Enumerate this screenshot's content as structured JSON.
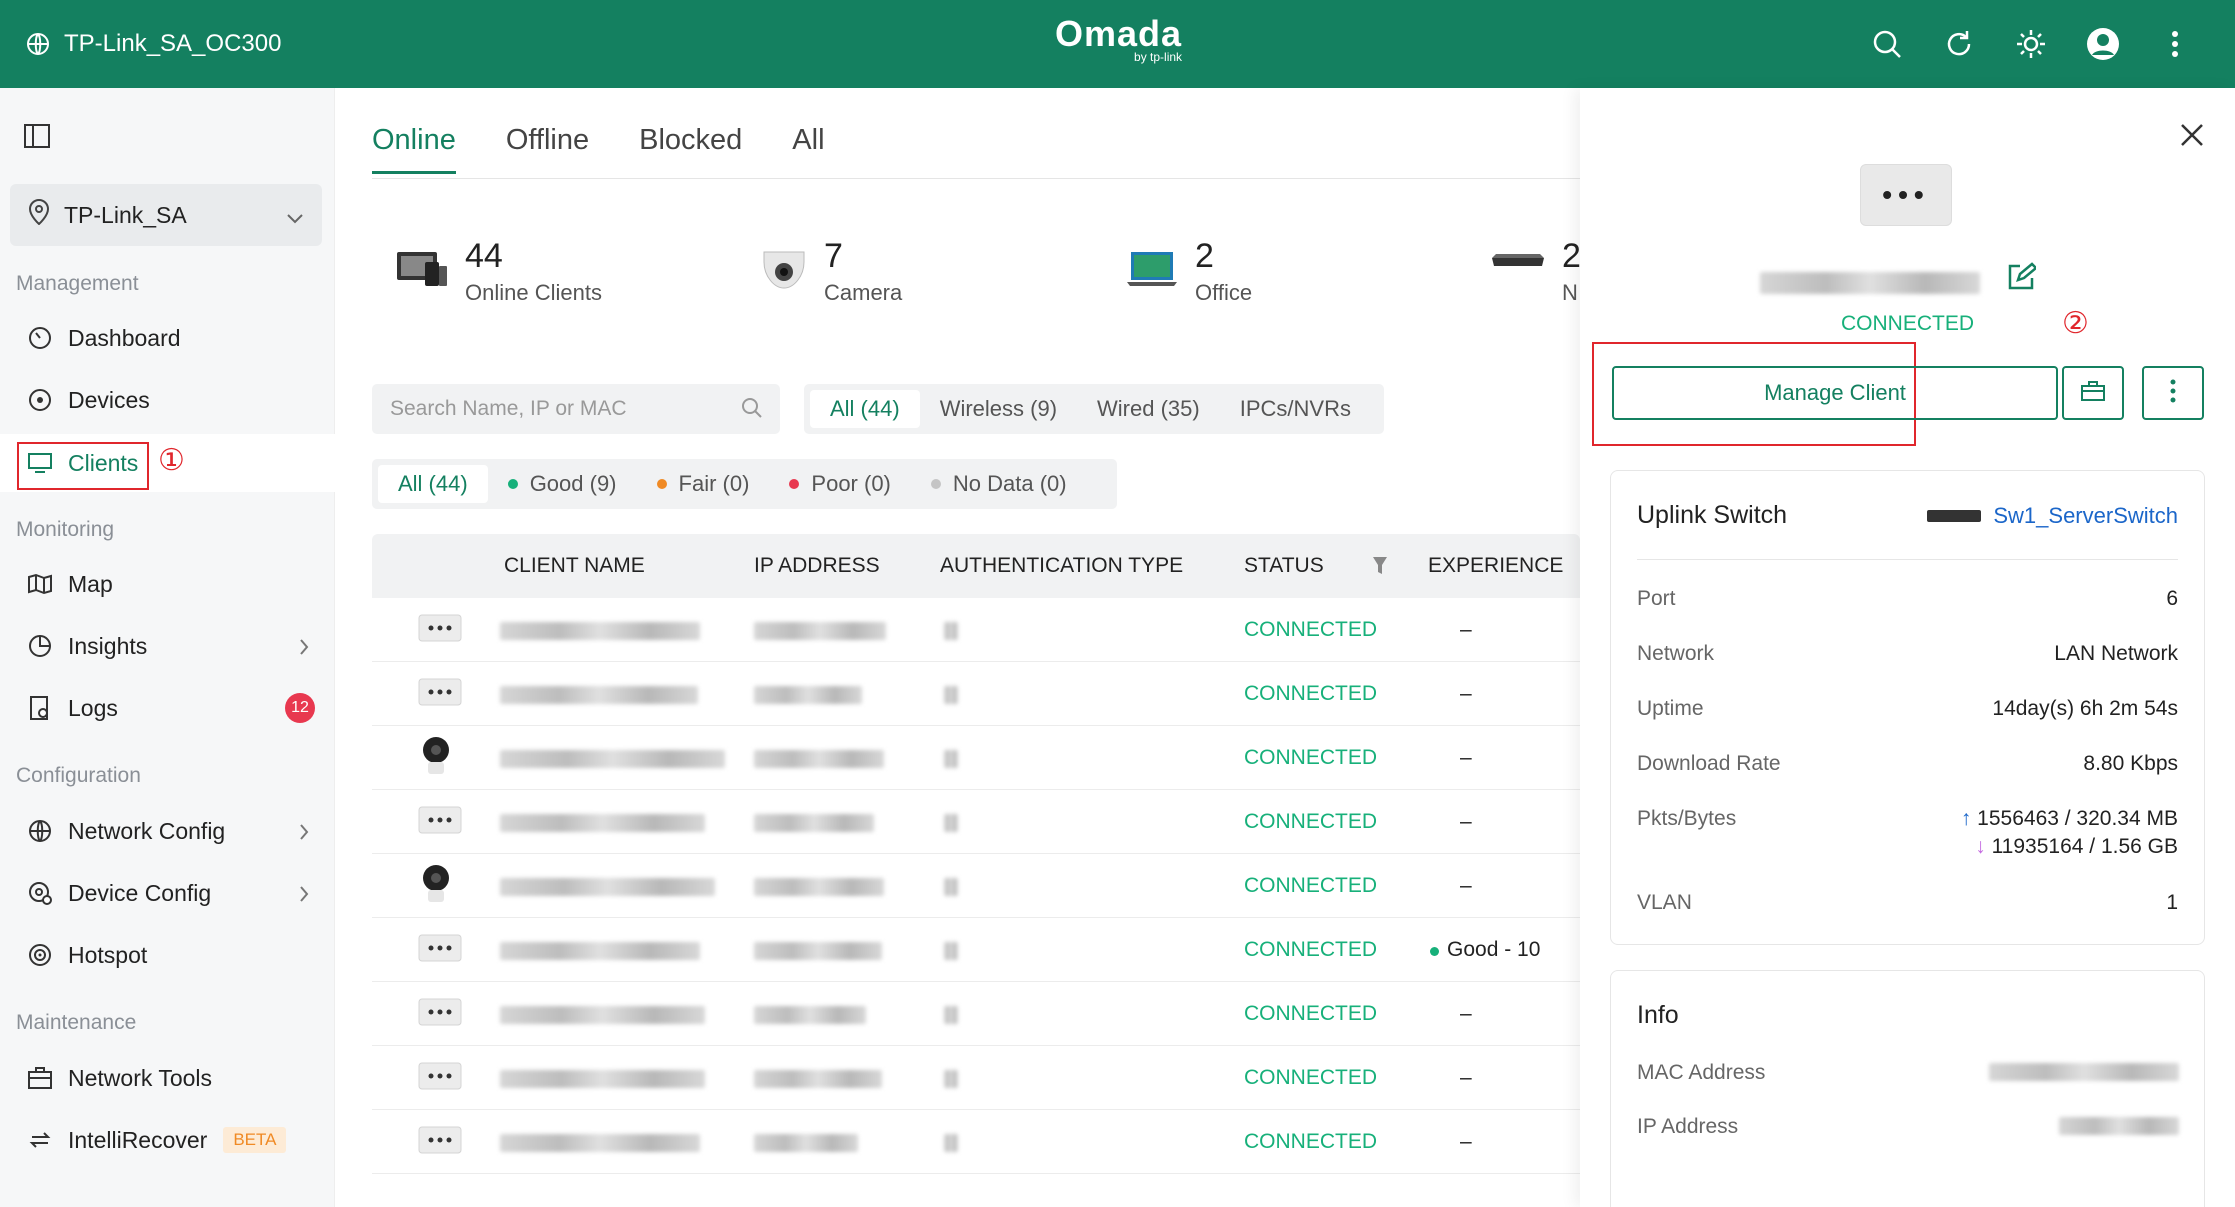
{
  "header": {
    "site_name": "TP-Link_SA_OC300",
    "logo": "Omada",
    "logo_sub": "by tp-link"
  },
  "sidebar": {
    "site_select": "TP-Link_SA",
    "sections": {
      "management": "Management",
      "monitoring": "Monitoring",
      "configuration": "Configuration",
      "maintenance": "Maintenance"
    },
    "items": {
      "dashboard": "Dashboard",
      "devices": "Devices",
      "clients": "Clients",
      "map": "Map",
      "insights": "Insights",
      "logs": "Logs",
      "logs_badge": "12",
      "network_config": "Network Config",
      "device_config": "Device Config",
      "hotspot": "Hotspot",
      "network_tools": "Network Tools",
      "intellirecover": "IntelliRecover",
      "beta": "BETA"
    },
    "annotation_1": "①"
  },
  "main": {
    "tabs": [
      "Online",
      "Offline",
      "Blocked",
      "All"
    ],
    "stats": [
      {
        "num": "44",
        "label": "Online Clients"
      },
      {
        "num": "7",
        "label": "Camera"
      },
      {
        "num": "2",
        "label": "Office"
      },
      {
        "num": "2",
        "label": "N"
      }
    ],
    "search_placeholder": "Search Name, IP or MAC",
    "type_filters": [
      "All (44)",
      "Wireless (9)",
      "Wired (35)",
      "IPCs/NVRs"
    ],
    "experience_filters": [
      "All (44)",
      "Good (9)",
      "Fair (0)",
      "Poor (0)",
      "No Data (0)"
    ],
    "columns": [
      "CLIENT NAME",
      "IP ADDRESS",
      "AUTHENTICATION TYPE",
      "STATUS",
      "EXPERIENCE"
    ],
    "rows": [
      {
        "status": "CONNECTED",
        "experience": "–"
      },
      {
        "status": "CONNECTED",
        "experience": "–"
      },
      {
        "status": "CONNECTED",
        "experience": "–"
      },
      {
        "status": "CONNECTED",
        "experience": "–"
      },
      {
        "status": "CONNECTED",
        "experience": "–"
      },
      {
        "status": "CONNECTED",
        "experience": "Good - 10"
      },
      {
        "status": "CONNECTED",
        "experience": "–"
      },
      {
        "status": "CONNECTED",
        "experience": "–"
      },
      {
        "status": "CONNECTED",
        "experience": "–"
      }
    ]
  },
  "panel": {
    "status": "CONNECTED",
    "manage_button": "Manage Client",
    "annotation_2": "②",
    "uplink": {
      "title": "Uplink Switch",
      "switch_name": "Sw1_ServerSwitch",
      "port_label": "Port",
      "port": "6",
      "network_label": "Network",
      "network": "LAN Network",
      "uptime_label": "Uptime",
      "uptime": "14day(s) 6h 2m 54s",
      "download_label": "Download Rate",
      "download": "8.80 Kbps",
      "pkts_label": "Pkts/Bytes",
      "pkts_up": "1556463 / 320.34 MB",
      "pkts_down": "11935164 / 1.56 GB",
      "vlan_label": "VLAN",
      "vlan": "1"
    },
    "info": {
      "title": "Info",
      "mac_label": "MAC Address",
      "ip_label": "IP Address"
    }
  }
}
